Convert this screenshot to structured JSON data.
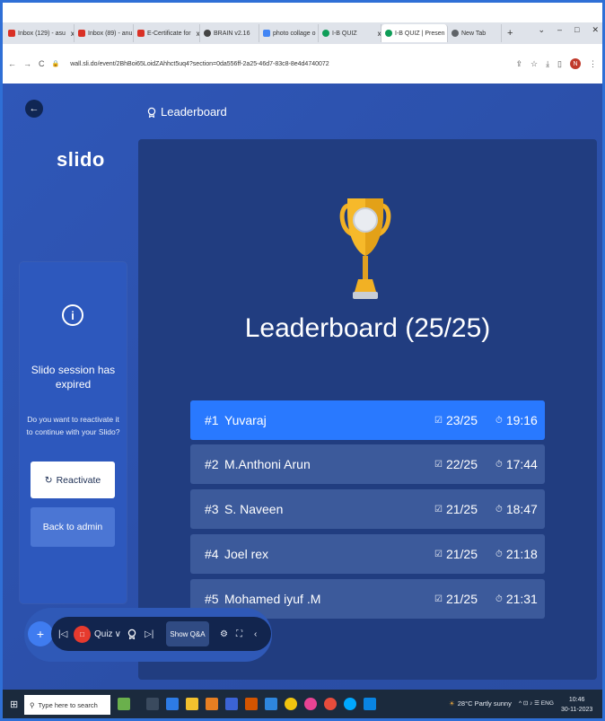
{
  "browser": {
    "tabs": [
      {
        "label": "Inbox (129) - asu",
        "favicon_color": "#d93025"
      },
      {
        "label": "Inbox (89) - anu",
        "favicon_color": "#d93025"
      },
      {
        "label": "E-Certificate for",
        "favicon_color": "#d93025"
      },
      {
        "label": "BRAIN v2.16",
        "favicon_color": "#444444"
      },
      {
        "label": "photo collage o",
        "favicon_color": "#4285f4"
      },
      {
        "label": "I-B QUIZ",
        "favicon_color": "#0f9d58"
      },
      {
        "label": "I-B QUIZ | Presen",
        "favicon_color": "#0f9d58",
        "active": true
      },
      {
        "label": "New Tab",
        "favicon_color": "#5f6368"
      }
    ],
    "tab_close": "x",
    "new_tab": "+",
    "window_controls": [
      "⌄",
      "–",
      "□",
      "✕"
    ],
    "nav": {
      "back": "←",
      "forward": "→",
      "reload": "C"
    },
    "url": "wall.sli.do/event/2BhBoi65LoidZAhhct5uq4?section=0da556ff-2a25-46d7-83c8-8e4d4740072",
    "avatar_letter": "N",
    "toolbar_icons": [
      "⇪",
      "☆",
      "⤓",
      "▯",
      "⋮"
    ]
  },
  "slido": {
    "back_icon": "←",
    "header_label": "Leaderboard",
    "brand": "slido",
    "sidebar": {
      "title_line1": "Slido session has",
      "title_line2": "expired",
      "message_line1": "Do you want to reactivate it",
      "message_line2": "to continue with your Slido?",
      "reactivate_label": "Reactivate",
      "back_admin_label": "Back to admin"
    },
    "leaderboard": {
      "title": "Leaderboard (25/25)",
      "rows": [
        {
          "rank": "#1",
          "name": "Yuvaraj",
          "score": "23/25",
          "time": "19:16"
        },
        {
          "rank": "#2",
          "name": "M.Anthoni Arun",
          "score": "22/25",
          "time": "17:44"
        },
        {
          "rank": "#3",
          "name": "S. Naveen",
          "score": "21/25",
          "time": "18:47"
        },
        {
          "rank": "#4",
          "name": "Joel rex",
          "score": "21/25",
          "time": "21:18"
        },
        {
          "rank": "#5",
          "name": "Mohamed iyuf .M",
          "score": "21/25",
          "time": "21:31"
        }
      ]
    },
    "toolbar": {
      "add": "+",
      "prev": "|◁",
      "stop": "□",
      "quiz_label": "Quiz",
      "quiz_chevron": "∨",
      "next": "▷|",
      "show_qa": "Show Q&A",
      "settings": "⚙",
      "fullscreen": "⛶",
      "collapse": "‹"
    }
  },
  "taskbar": {
    "start": "⊞",
    "search_placeholder": "Type here to search",
    "weather": "28°C Partly sunny",
    "tray": "^ ⊡ ♪ ☰ ENG",
    "time": "10:46",
    "date": "30-11-2023"
  }
}
